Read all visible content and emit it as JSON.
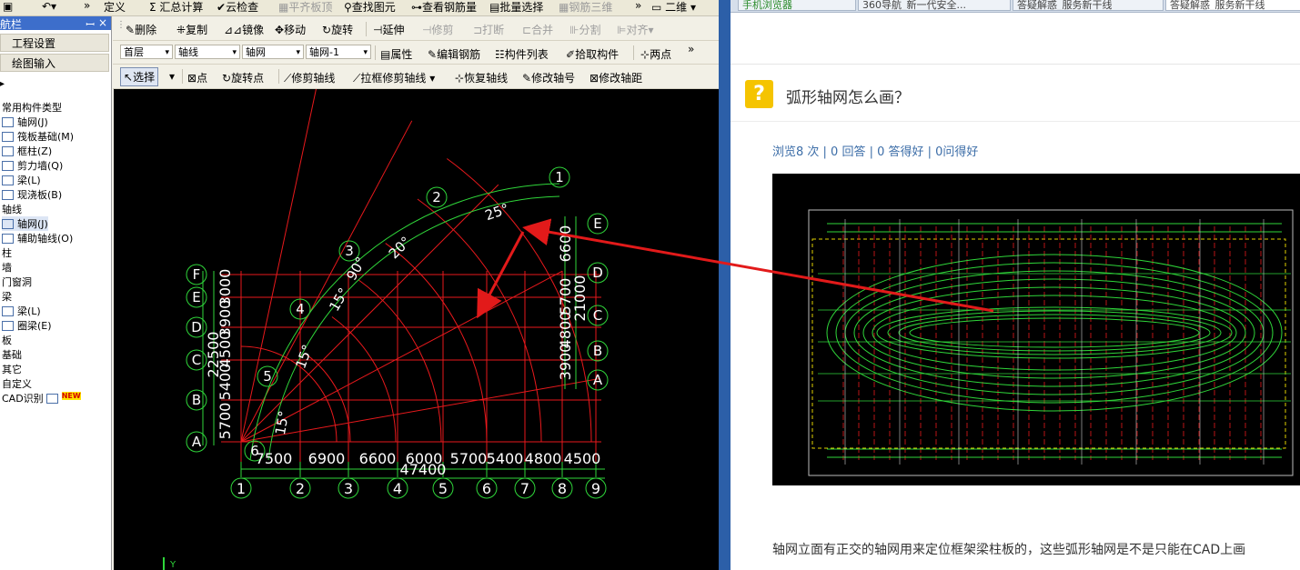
{
  "app": {
    "menu": [
      "定义",
      "汇总计算",
      "云检查",
      "平齐板顶",
      "查找图元",
      "查看钢筋量",
      "批量选择",
      "钢筋三维",
      "二维"
    ],
    "toolbar1": {
      "delete": "删除",
      "copy": "复制",
      "mirror": "镜像",
      "move": "移动",
      "rotate": "旋转",
      "extend": "延伸",
      "trim": "修剪",
      "break": "打断",
      "merge": "合并",
      "split": "分割",
      "align": "对齐"
    },
    "toolbar2": {
      "floor": "首层",
      "category": "轴线",
      "type": "轴网",
      "instance": "轴网-1",
      "property": "属性",
      "edit_rebar": "编辑钢筋",
      "component_list": "构件列表",
      "pick": "拾取构件",
      "two_points": "两点"
    },
    "toolbar3": {
      "select": "选择",
      "point": "点",
      "rotate_point": "旋转点",
      "trim_axis": "修剪轴线",
      "box_trim_axis": "拉框修剪轴线",
      "restore_axis": "恢复轴线",
      "edit_axis_no": "修改轴号",
      "edit_axis_dist": "修改轴距"
    },
    "panel": {
      "title": "航栏",
      "project_settings": "工程设置",
      "drawing_input": "绘图输入",
      "tree": [
        {
          "label": "常用构件类型",
          "kind": "cat"
        },
        {
          "label": "轴网(J)",
          "kind": "item"
        },
        {
          "label": "筏板基础(M)",
          "kind": "item"
        },
        {
          "label": "框柱(Z)",
          "kind": "item"
        },
        {
          "label": "剪力墙(Q)",
          "kind": "item"
        },
        {
          "label": "梁(L)",
          "kind": "item"
        },
        {
          "label": "现浇板(B)",
          "kind": "item"
        },
        {
          "label": "轴线",
          "kind": "cat"
        },
        {
          "label": "轴网(J)",
          "kind": "item-sel"
        },
        {
          "label": "辅助轴线(O)",
          "kind": "item"
        },
        {
          "label": "柱",
          "kind": "cat"
        },
        {
          "label": "墙",
          "kind": "cat"
        },
        {
          "label": "门窗洞",
          "kind": "cat"
        },
        {
          "label": "梁",
          "kind": "cat"
        },
        {
          "label": "梁(L)",
          "kind": "item"
        },
        {
          "label": "圈梁(E)",
          "kind": "item"
        },
        {
          "label": "板",
          "kind": "cat"
        },
        {
          "label": "基础",
          "kind": "cat"
        },
        {
          "label": "其它",
          "kind": "cat"
        },
        {
          "label": "自定义",
          "kind": "cat"
        },
        {
          "label": "CAD识别",
          "kind": "cat-new"
        }
      ],
      "new_badge": "NEW"
    },
    "drawing": {
      "axis_numbers": [
        "1",
        "2",
        "3",
        "4",
        "5",
        "6",
        "7",
        "8",
        "9"
      ],
      "axis_letters": [
        "A",
        "B",
        "C",
        "D",
        "E",
        "F"
      ],
      "bottom_dims": [
        "7500",
        "6900",
        "6600",
        "6000",
        "5700",
        "5400",
        "4800",
        "4500"
      ],
      "bottom_total": "47400",
      "left_dims": [
        "5700",
        "5400",
        "4500",
        "3900",
        "3000"
      ],
      "left_total": "22500",
      "right_dims": [
        "3900",
        "4800",
        "5700",
        "6600"
      ],
      "right_total": "21000",
      "angles": [
        "25°",
        "20°",
        "90°",
        "15°",
        "15°",
        "15°"
      ],
      "ucs": "Y"
    }
  },
  "browser": {
    "tabs": [
      "手机浏览器",
      "360导航_新一代安全...",
      "答疑解惑_服务新干线",
      "答疑解惑_服务新干线"
    ],
    "question_title": "弧形轴网怎么画？",
    "stats": "浏览8 次 | 0 回答 | 0 答得好 | 0问得好",
    "answer_text": "轴网立面有正交的轴网用来定位框架梁柱板的，这些弧形轴网是不是只能在CAD上画"
  },
  "colors": {
    "grid_red": "#e8191c",
    "grid_green": "#2fd63a",
    "arrow": "#e21a1a",
    "panel_blue": "#2c5fa8"
  }
}
